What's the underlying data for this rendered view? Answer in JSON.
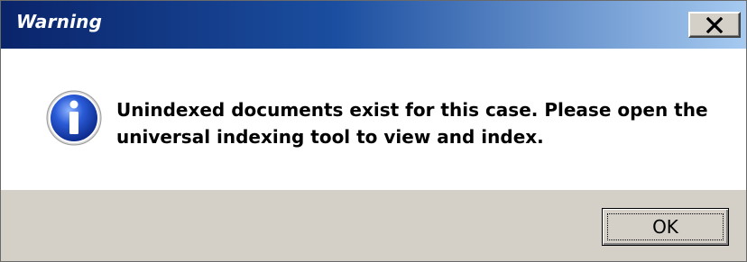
{
  "window": {
    "title": "Warning",
    "title_colors": {
      "start": "#0a246a",
      "end": "#a6caf0",
      "text": "#ffffff"
    },
    "close_icon": "close-icon"
  },
  "message": {
    "icon": "info-icon",
    "text": "Unindexed documents exist for this case.  Please open the\nuniversal indexing tool to view and index."
  },
  "buttons": {
    "ok_label": "OK"
  },
  "colors": {
    "footer_background": "#d4d0c8",
    "info_icon_blue": "#2a5bd7"
  }
}
